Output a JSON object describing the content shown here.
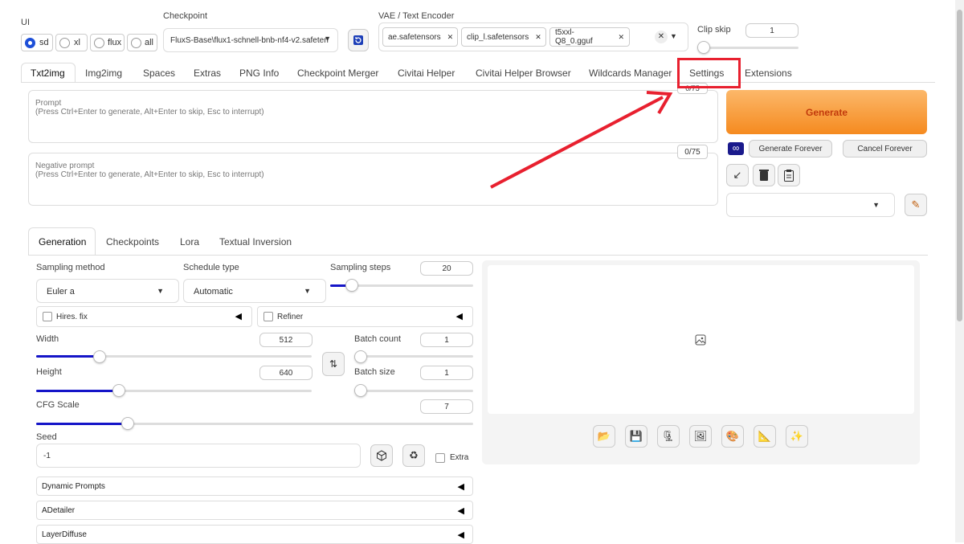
{
  "ui": {
    "label": "UI",
    "options": [
      "sd",
      "xl",
      "flux",
      "all"
    ],
    "selected": "sd"
  },
  "checkpoint": {
    "label": "Checkpoint",
    "value": "FluxS-Base\\flux1-schnell-bnb-nf4-v2.safeten"
  },
  "vae": {
    "label": "VAE / Text Encoder",
    "chips": [
      "ae.safetensors",
      "clip_l.safetensors",
      "t5xxl-Q8_0.gguf"
    ]
  },
  "clip_skip": {
    "label": "Clip skip",
    "value": "1"
  },
  "tabs": [
    "Txt2img",
    "Img2img",
    "Spaces",
    "Extras",
    "PNG Info",
    "Checkpoint Merger",
    "Civitai Helper",
    "Civitai Helper Browser",
    "Wildcards Manager",
    "Settings",
    "Extensions"
  ],
  "prompt": {
    "label": "Prompt",
    "hint": "(Press Ctrl+Enter to generate, Alt+Enter to skip, Esc to interrupt)",
    "counter": "0/75"
  },
  "negative_prompt": {
    "label": "Negative prompt",
    "hint": "(Press Ctrl+Enter to generate, Alt+Enter to skip, Esc to interrupt)",
    "counter": "0/75"
  },
  "generate": {
    "label": "Generate",
    "forever": "Generate Forever",
    "cancel_forever": "Cancel Forever",
    "accent": "#f58a1f"
  },
  "subtabs": [
    "Generation",
    "Checkpoints",
    "Lora",
    "Textual Inversion"
  ],
  "sampling": {
    "method_label": "Sampling method",
    "method_value": "Euler a",
    "schedule_label": "Schedule type",
    "schedule_value": "Automatic",
    "steps_label": "Sampling steps",
    "steps_value": "20",
    "steps_fraction": 0.15
  },
  "hires": {
    "label": "Hires. fix"
  },
  "refiner": {
    "label": "Refiner"
  },
  "width": {
    "label": "Width",
    "value": "512",
    "fraction": 0.23
  },
  "height": {
    "label": "Height",
    "value": "640",
    "fraction": 0.3
  },
  "batch_count": {
    "label": "Batch count",
    "value": "1",
    "fraction": 0
  },
  "batch_size": {
    "label": "Batch size",
    "value": "1",
    "fraction": 0
  },
  "cfg": {
    "label": "CFG Scale",
    "value": "7",
    "fraction": 0.21
  },
  "seed": {
    "label": "Seed",
    "value": "-1",
    "extra_label": "Extra"
  },
  "accordions": [
    "Dynamic Prompts",
    "ADetailer",
    "LayerDiffuse"
  ],
  "highlight_color": "#e8202f"
}
